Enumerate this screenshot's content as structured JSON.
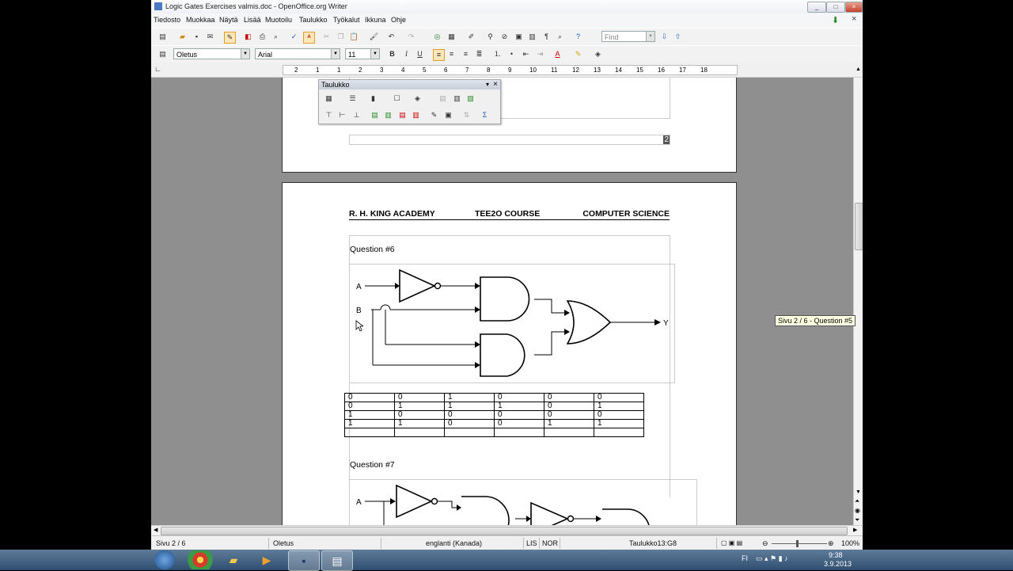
{
  "window": {
    "title": "Logic Gates Exercises valmis.doc - OpenOffice.org Writer",
    "controls": [
      "_",
      "□",
      "×"
    ]
  },
  "menu": [
    "Tiedosto",
    "Muokkaa",
    "Näytä",
    "Lisää",
    "Muotoilu",
    "Taulukko",
    "Työkalut",
    "Ikkuna",
    "Ohje"
  ],
  "toolbar": {
    "find_placeholder": "Find",
    "style": "Oletus",
    "font": "Arial",
    "size": "11",
    "bold": "B",
    "italic": "I",
    "underline": "U"
  },
  "ruler": {
    "ticks": [
      "2",
      "1",
      "1",
      "2",
      "3",
      "4",
      "5",
      "6",
      "7",
      "8",
      "9",
      "10",
      "11",
      "12",
      "13",
      "14",
      "15",
      "16",
      "17",
      "18"
    ]
  },
  "float_toolbar": {
    "title": "Taulukko"
  },
  "page1": {
    "page_number": "2"
  },
  "page2": {
    "header": {
      "school": "R. H. KING ACADEMY",
      "course": "TEE2O COURSE",
      "subject": "COMPUTER SCIENCE"
    },
    "q6": {
      "label": "Question #6",
      "inA": "A",
      "inB": "B",
      "out": "Y"
    },
    "truth_table": [
      [
        "0",
        "0",
        "1",
        "0",
        "0",
        "0"
      ],
      [
        "0",
        "1",
        "1",
        "1",
        "0",
        "1"
      ],
      [
        "1",
        "0",
        "0",
        "0",
        "0",
        "0"
      ],
      [
        "1",
        "1",
        "0",
        "0",
        "1",
        "1"
      ],
      [
        "",
        "",
        "",
        "",
        "",
        ""
      ]
    ],
    "q7": {
      "label": "Question #7",
      "inA": "A"
    }
  },
  "tooltip": "Sivu 2 / 6  - Question #5",
  "status": {
    "page": "Sivu 2 / 6",
    "style": "Oletus",
    "language": "englanti (Kanada)",
    "mode1": "LIS",
    "mode2": "NOR",
    "cell": "Taulukko13:G8",
    "zoom": "100%"
  },
  "taskbar": {
    "lang": "FI",
    "time": "9:38",
    "date": "3.9.2013"
  }
}
